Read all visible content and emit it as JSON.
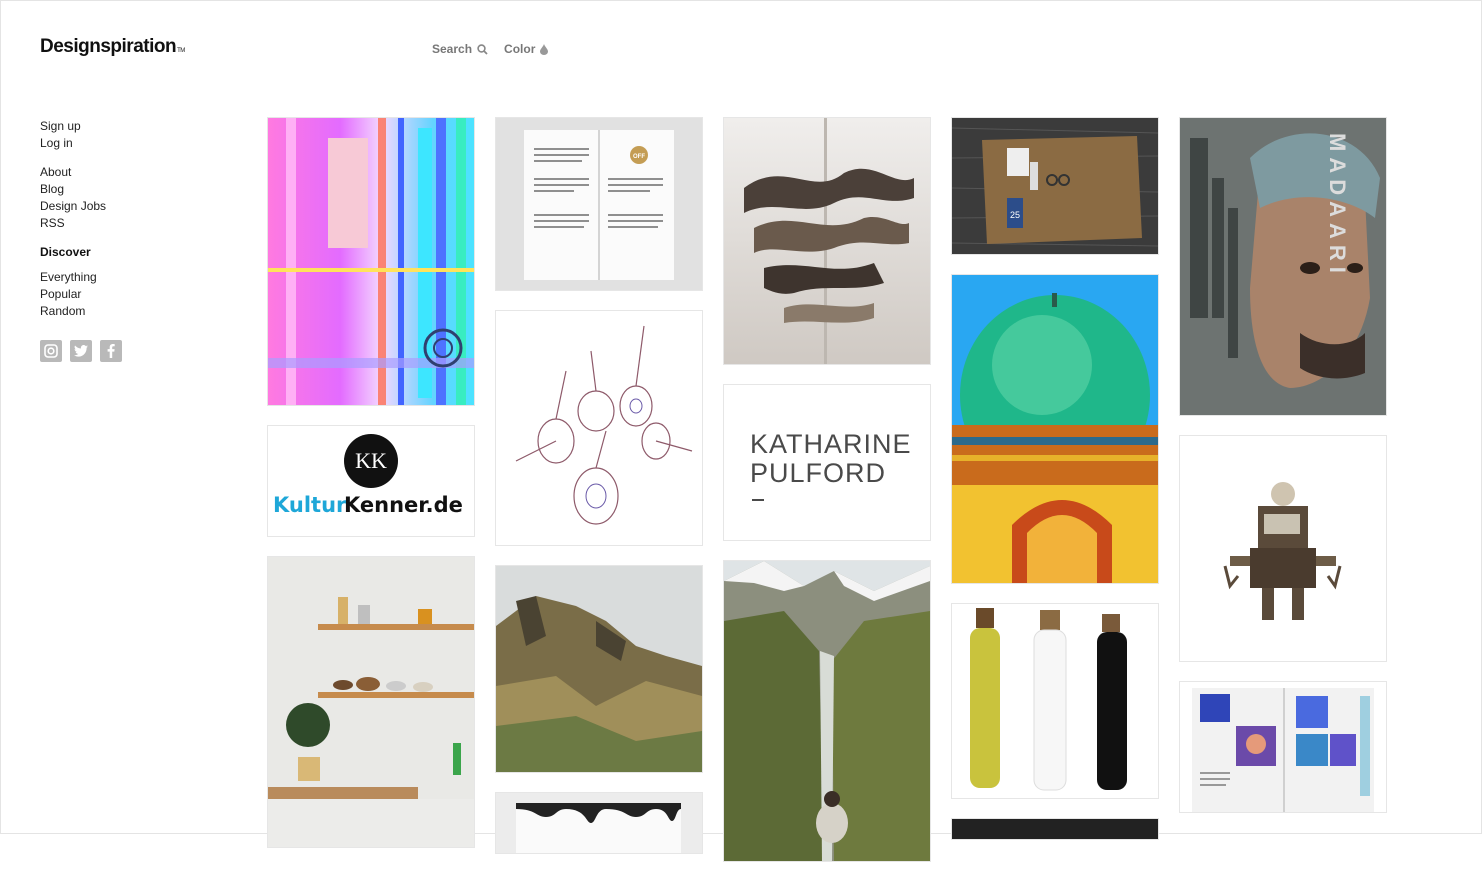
{
  "brand": {
    "name": "Designspiration",
    "tm": "TM"
  },
  "topnav": {
    "search_label": "Search",
    "color_label": "Color"
  },
  "sidebar": {
    "account": [
      {
        "label": "Sign up"
      },
      {
        "label": "Log in"
      }
    ],
    "info": [
      {
        "label": "About"
      },
      {
        "label": "Blog"
      },
      {
        "label": "Design Jobs"
      },
      {
        "label": "RSS"
      }
    ],
    "discover_heading": "Discover",
    "discover": [
      {
        "label": "Everything"
      },
      {
        "label": "Popular"
      },
      {
        "label": "Random"
      }
    ],
    "social": [
      "instagram-icon",
      "twitter-icon",
      "facebook-icon"
    ]
  },
  "tiles": {
    "kulturkenner": {
      "monogram": "KK",
      "kultur": "Kultur",
      "kenner": "Kenner.de"
    },
    "magazine_badge": "OFF",
    "katharine": {
      "line1": "KATHARINE",
      "line2": "PULFORD"
    },
    "shop_tag": "25",
    "madaari": {
      "title": "MADAARI"
    }
  }
}
